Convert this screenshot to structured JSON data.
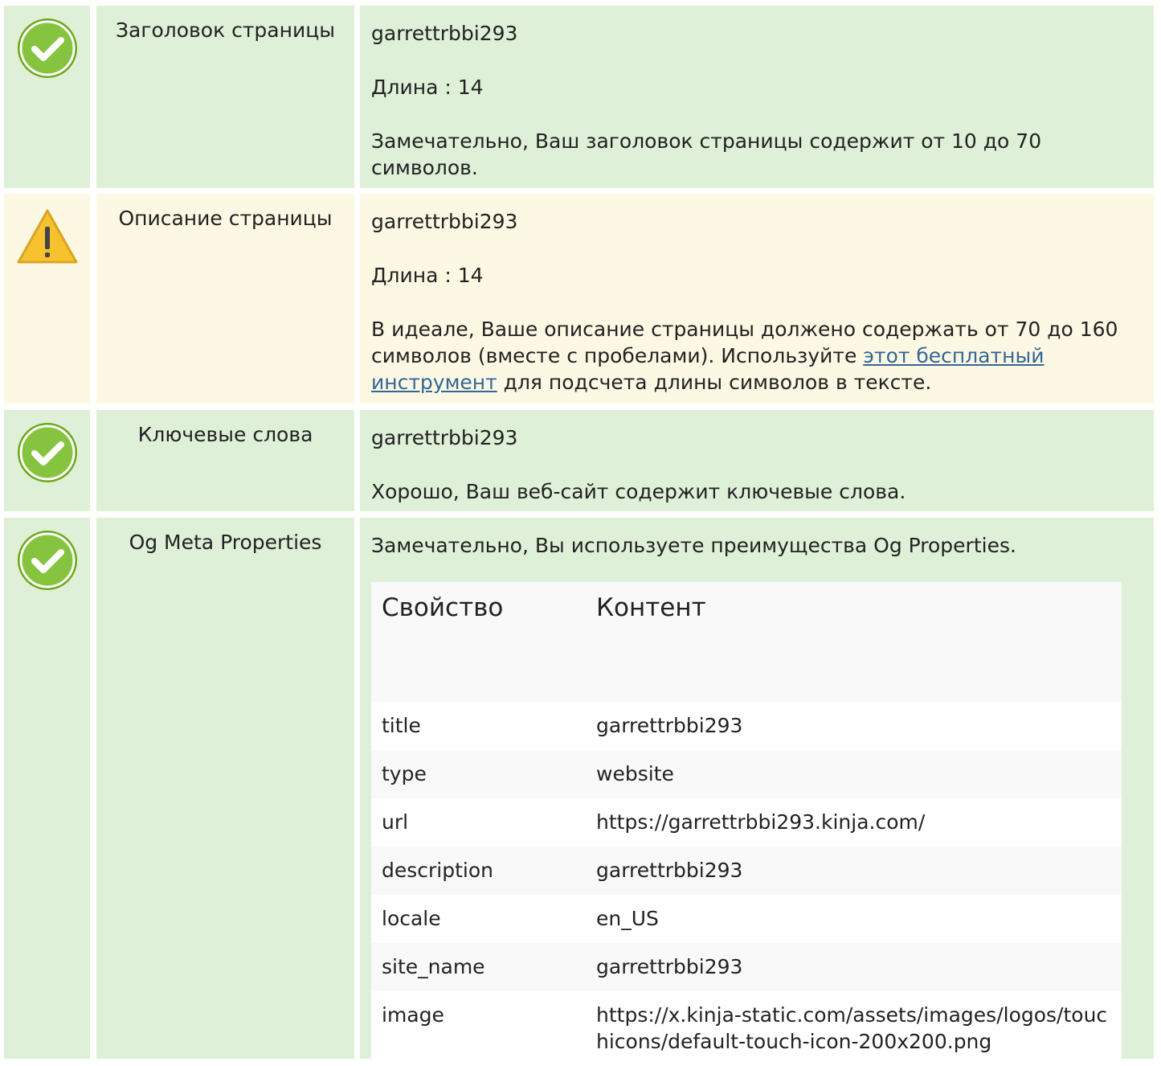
{
  "rows": {
    "title": {
      "label": "Заголовок страницы",
      "value": "garrettrbbi293",
      "length": "Длина : 14",
      "message": "Замечательно, Ваш заголовок страницы содержит от 10 до 70 символов.",
      "status": "ok"
    },
    "description": {
      "label": "Описание страницы",
      "value": "garrettrbbi293",
      "length": "Длина : 14",
      "message_before": "В идеале, Ваше описание страницы должено содержать от 70 до 160 символов (вместе с пробелами). Используйте ",
      "link_text": "этот бесплатный инструмент",
      "message_after": " для подсчета длины символов в тексте.",
      "status": "warning"
    },
    "keywords": {
      "label": "Ключевые слова",
      "value": "garrettrbbi293",
      "message": "Хорошо, Ваш веб-сайт содержит ключевые слова.",
      "status": "ok"
    },
    "og": {
      "label": "Og Meta Properties",
      "message": "Замечательно, Вы используете преимущества Og Properties.",
      "status": "ok",
      "table": {
        "headers": {
          "property": "Свойство",
          "content": "Контент"
        },
        "items": [
          {
            "property": "title",
            "content": "garrettrbbi293"
          },
          {
            "property": "type",
            "content": "website"
          },
          {
            "property": "url",
            "content": "https://garrettrbbi293.kinja.com/"
          },
          {
            "property": "description",
            "content": "garrettrbbi293"
          },
          {
            "property": "locale",
            "content": "en_US"
          },
          {
            "property": "site_name",
            "content": "garrettrbbi293"
          },
          {
            "property": "image",
            "content": "https://x.kinja-static.com/assets/images/logos/touchicons/default-touch-icon-200x200.png"
          }
        ]
      }
    }
  },
  "colors": {
    "ok_bg": "#dff0d8",
    "warning_bg": "#fcf8e3",
    "ok_icon": "#7cbd1e",
    "warning_icon": "#f7c22f",
    "link": "#336699"
  }
}
